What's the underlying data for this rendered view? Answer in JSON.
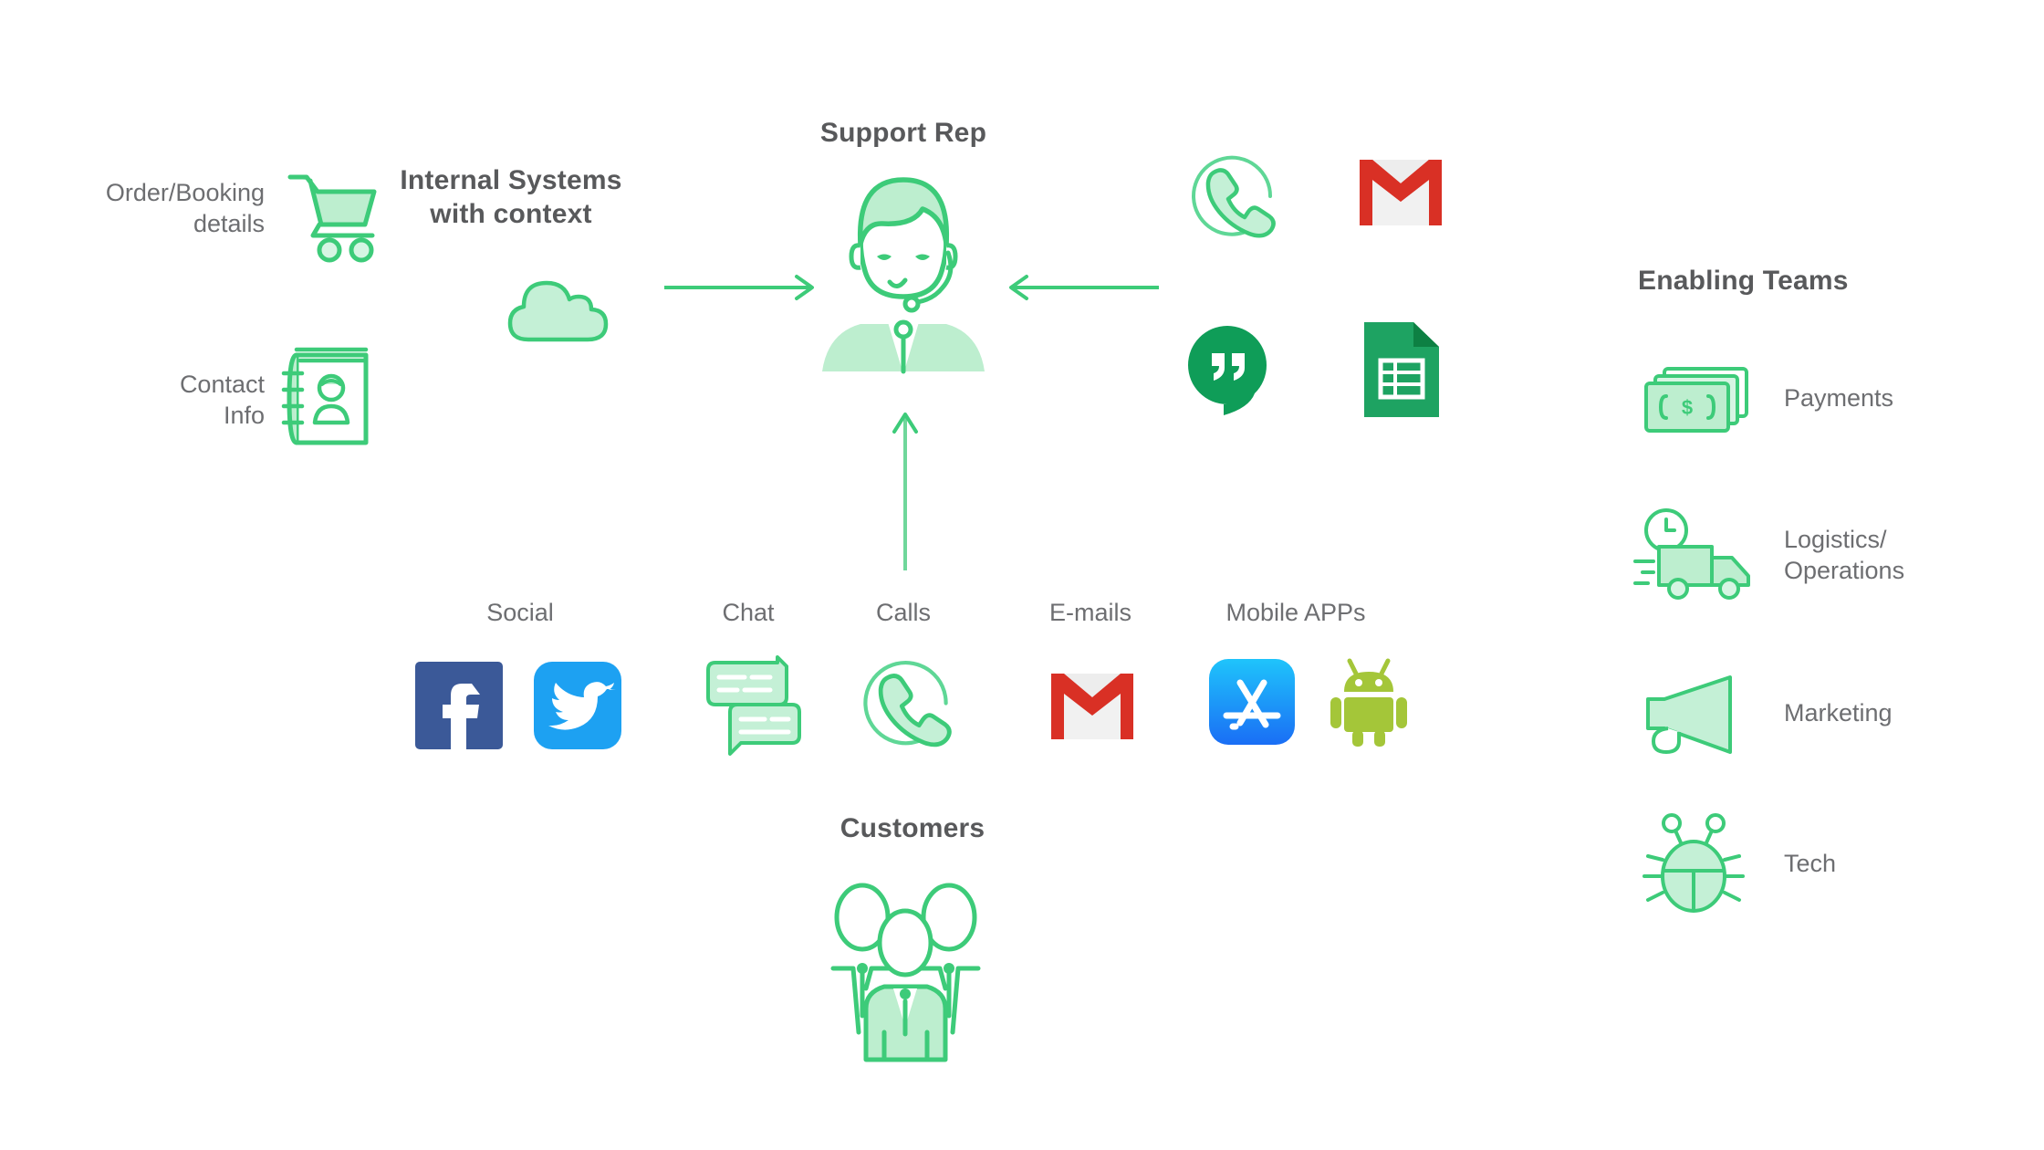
{
  "diagram": {
    "title_nodes": {
      "support_rep": "Support Rep",
      "customers": "Customers",
      "enabling_teams": "Enabling Teams",
      "internal_systems": "Internal Systems\nwith context"
    },
    "left_sources": [
      {
        "label": "Order/Booking\ndetails",
        "icon": "shopping-cart-icon"
      },
      {
        "label": "Contact\nInfo",
        "icon": "contact-book-icon"
      }
    ],
    "internal_system_icon": "cloud-icon",
    "agent_tools": [
      {
        "icon": "phone-circle-icon",
        "name": "phone"
      },
      {
        "icon": "gmail-icon",
        "name": "gmail"
      },
      {
        "icon": "hangouts-icon",
        "name": "hangouts"
      },
      {
        "icon": "google-sheets-icon",
        "name": "sheets"
      }
    ],
    "channels": [
      {
        "label": "Social",
        "icons": [
          "facebook-icon",
          "twitter-icon"
        ]
      },
      {
        "label": "Chat",
        "icons": [
          "chat-bubbles-icon"
        ]
      },
      {
        "label": "Calls",
        "icons": [
          "phone-circle-icon"
        ]
      },
      {
        "label": "E-mails",
        "icons": [
          "gmail-icon"
        ]
      },
      {
        "label": "Mobile APPs",
        "icons": [
          "app-store-icon",
          "android-icon"
        ]
      }
    ],
    "enabling_teams": [
      {
        "label": "Payments",
        "icon": "money-icon"
      },
      {
        "label": "Logistics/\nOperations",
        "icon": "delivery-truck-icon"
      },
      {
        "label": "Marketing",
        "icon": "megaphone-icon"
      },
      {
        "label": "Tech",
        "icon": "bug-icon"
      }
    ],
    "arrows": [
      {
        "name": "arrow-internal-to-rep",
        "direction": "right"
      },
      {
        "name": "arrow-tools-to-rep",
        "direction": "left"
      },
      {
        "name": "arrow-customers-to-rep",
        "direction": "up"
      }
    ],
    "colors": {
      "green_stroke": "#3DCB79",
      "green_fill": "#BDEECF",
      "green_fill_light": "#D6F5E3",
      "text_dark": "#58595b",
      "text_gray": "#6d6e71",
      "facebook_blue": "#3B5998",
      "twitter_blue": "#1DA1F2",
      "gmail_red": "#D93025",
      "gmail_light": "#EDEDED",
      "hangouts_green": "#0F9D58",
      "sheets_green": "#1EA362",
      "android_green": "#A4C639",
      "appstore_blue_top": "#1FC4FB",
      "appstore_blue_bottom": "#1A6EF5",
      "background": "#FFFFFF"
    }
  }
}
